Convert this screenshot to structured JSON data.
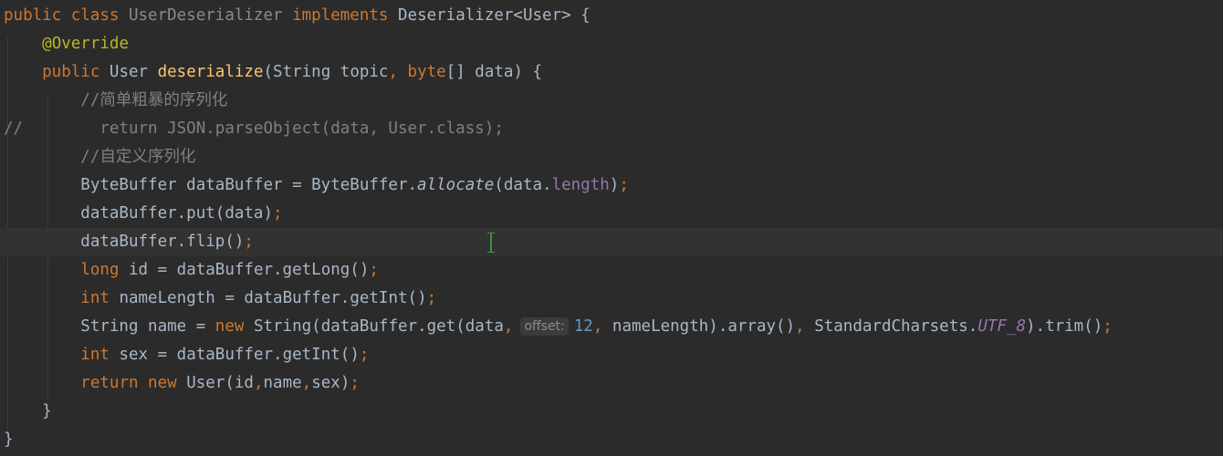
{
  "editor": {
    "lines": [
      {
        "segments": [
          {
            "t": "public class ",
            "c": "kw"
          },
          {
            "t": "UserDeserializer ",
            "c": "muted"
          },
          {
            "t": "implements ",
            "c": "kw"
          },
          {
            "t": "Deserializer<User> {",
            "c": ""
          }
        ]
      },
      {
        "segments": [
          {
            "t": "    ",
            "c": ""
          },
          {
            "t": "@Override",
            "c": "ann"
          }
        ]
      },
      {
        "segments": [
          {
            "t": "    public ",
            "c": "kw"
          },
          {
            "t": "User ",
            "c": ""
          },
          {
            "t": "deserialize",
            "c": "fn"
          },
          {
            "t": "(String topic",
            "c": ""
          },
          {
            "t": ", ",
            "c": "kw"
          },
          {
            "t": "byte",
            "c": "kw"
          },
          {
            "t": "[] data) {",
            "c": ""
          }
        ]
      },
      {
        "segments": [
          {
            "t": "        //简单粗暴的序列化",
            "c": "cmt"
          }
        ]
      },
      {
        "marker": "//",
        "segments": [
          {
            "t": "          return JSON.parseObject(data, User.class);",
            "c": "cmt"
          }
        ]
      },
      {
        "segments": [
          {
            "t": "        //自定义序列化",
            "c": "cmt"
          }
        ]
      },
      {
        "segments": [
          {
            "t": "        ByteBuffer dataBuffer = ByteBuffer.",
            "c": ""
          },
          {
            "t": "allocate",
            "c": "ital"
          },
          {
            "t": "(data.",
            "c": ""
          },
          {
            "t": "length",
            "c": "field"
          },
          {
            "t": ")",
            "c": ""
          },
          {
            "t": ";",
            "c": "kw"
          }
        ]
      },
      {
        "segments": [
          {
            "t": "        dataBuffer.put(data)",
            "c": ""
          },
          {
            "t": ";",
            "c": "kw"
          }
        ]
      },
      {
        "current": true,
        "segments": [
          {
            "t": "        dataBuffer.flip()",
            "c": ""
          },
          {
            "t": ";",
            "c": "kw"
          }
        ]
      },
      {
        "segments": [
          {
            "t": "        ",
            "c": ""
          },
          {
            "t": "long ",
            "c": "kw"
          },
          {
            "t": "id = dataBuffer.getLong()",
            "c": ""
          },
          {
            "t": ";",
            "c": "kw"
          }
        ]
      },
      {
        "segments": [
          {
            "t": "        ",
            "c": ""
          },
          {
            "t": "int ",
            "c": "kw"
          },
          {
            "t": "nameLength = dataBuffer.getInt()",
            "c": ""
          },
          {
            "t": ";",
            "c": "kw"
          }
        ]
      },
      {
        "segments": [
          {
            "t": "        String name = ",
            "c": ""
          },
          {
            "t": "new ",
            "c": "kw"
          },
          {
            "t": "String(dataBuffer.get(data",
            "c": ""
          },
          {
            "t": ",",
            "c": "kw"
          },
          {
            "t": "offset:",
            "c": "hint"
          },
          {
            "t": "12",
            "c": "num"
          },
          {
            "t": ", ",
            "c": "kw"
          },
          {
            "t": "nameLength).array()",
            "c": ""
          },
          {
            "t": ", ",
            "c": "kw"
          },
          {
            "t": "StandardCharsets.",
            "c": ""
          },
          {
            "t": "UTF_8",
            "c": "stat"
          },
          {
            "t": ").trim()",
            "c": ""
          },
          {
            "t": ";",
            "c": "kw"
          }
        ]
      },
      {
        "segments": [
          {
            "t": "        ",
            "c": ""
          },
          {
            "t": "int ",
            "c": "kw"
          },
          {
            "t": "sex = dataBuffer.getInt()",
            "c": ""
          },
          {
            "t": ";",
            "c": "kw"
          }
        ]
      },
      {
        "segments": [
          {
            "t": "        ",
            "c": ""
          },
          {
            "t": "return new ",
            "c": "kw"
          },
          {
            "t": "User(id",
            "c": ""
          },
          {
            "t": ",",
            "c": "kw"
          },
          {
            "t": "name",
            "c": ""
          },
          {
            "t": ",",
            "c": "kw"
          },
          {
            "t": "sex)",
            "c": ""
          },
          {
            "t": ";",
            "c": "kw"
          }
        ]
      },
      {
        "segments": [
          {
            "t": "    }",
            "c": ""
          }
        ]
      },
      {
        "segments": [
          {
            "t": "}",
            "c": ""
          }
        ]
      }
    ]
  }
}
